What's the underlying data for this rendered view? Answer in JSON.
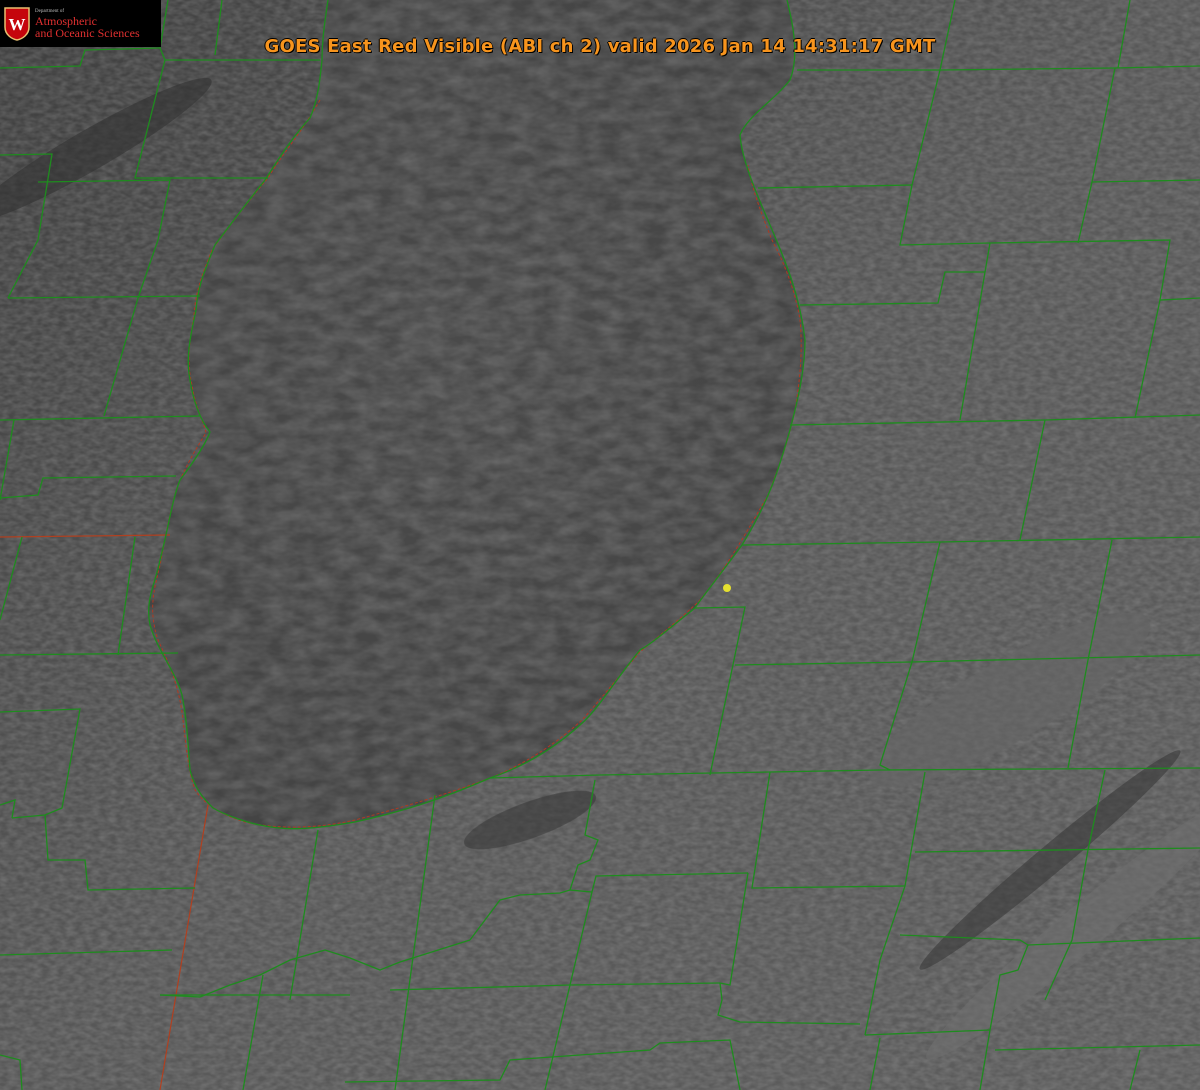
{
  "header": {
    "title": "GOES East Red Visible (ABI ch 2) valid 2026 Jan 14 14:31:17 GMT"
  },
  "logo": {
    "small_text": "Department of",
    "line1": "Atmospheric",
    "line2": "and Oceanic Sciences",
    "seal_letter": "W",
    "seal_color": "#c5050c"
  },
  "map": {
    "imagery": "satellite-visible-grayscale",
    "feature": "lake-michigan-southern-basin",
    "boundary_color": "#1e8c1e",
    "state_line_color": "#b04020",
    "marker_color": "#e5e030"
  }
}
